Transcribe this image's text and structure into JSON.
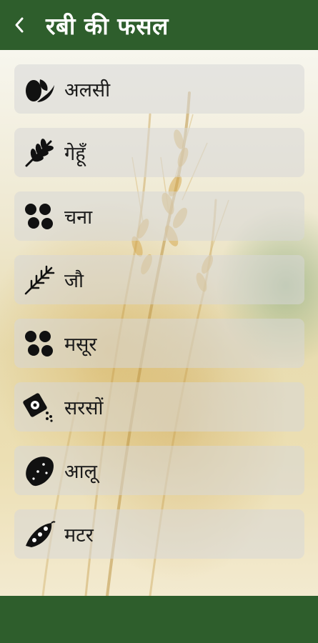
{
  "header": {
    "title": "रबी की फसल"
  },
  "crops": [
    {
      "label": "अलसी",
      "icon": "flaxseed-icon"
    },
    {
      "label": "गेहूँ",
      "icon": "wheat-ear-icon"
    },
    {
      "label": "चना",
      "icon": "chickpea-icon"
    },
    {
      "label": "जौ",
      "icon": "barley-icon"
    },
    {
      "label": "मसूर",
      "icon": "lentil-icon"
    },
    {
      "label": "सरसों",
      "icon": "mustard-seed-packet-icon"
    },
    {
      "label": "आलू",
      "icon": "potato-icon"
    },
    {
      "label": "मटर",
      "icon": "pea-pod-icon"
    }
  ],
  "theme": {
    "primary": "#2e5e2c",
    "item_background": "#d7d7d7"
  }
}
